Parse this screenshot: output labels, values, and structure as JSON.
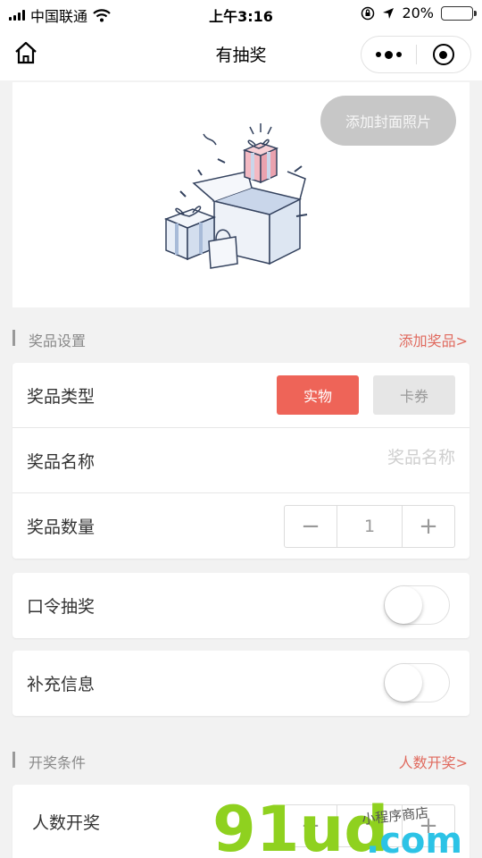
{
  "status_bar": {
    "carrier": "中国联通",
    "time": "上午3:16",
    "battery": "20%"
  },
  "nav": {
    "title": "有抽奖",
    "home_icon": "home-icon",
    "more_icon": "more-dots-icon",
    "close_icon": "record-icon"
  },
  "cover": {
    "add_cover_button": "添加封面照片"
  },
  "prize_section": {
    "title": "奖品设置",
    "link": "添加奖品>"
  },
  "prize_card": {
    "type_label": "奖品类型",
    "type_options": [
      "实物",
      "卡券"
    ],
    "name_label": "奖品名称",
    "name_value": "",
    "name_placeholder": "奖品名称",
    "count_label": "奖品数量",
    "count_minus": "−",
    "count_value": "1",
    "count_plus": "+"
  },
  "password_draw": {
    "label": "口令抽奖",
    "enabled": false
  },
  "extra_info": {
    "label": "补充信息",
    "enabled": false
  },
  "draw_section": {
    "title": "开奖条件",
    "link": "人数开奖>"
  },
  "draw_card": {
    "label": "人数开奖"
  },
  "watermark": {
    "main": "91ud",
    "suffix": ".com",
    "tagline": "小程序商店"
  },
  "colors": {
    "accent": "#ee6458",
    "link": "#e06a5e",
    "watermark_green": "#8fd11f",
    "watermark_cyan": "#2cc3e6"
  }
}
